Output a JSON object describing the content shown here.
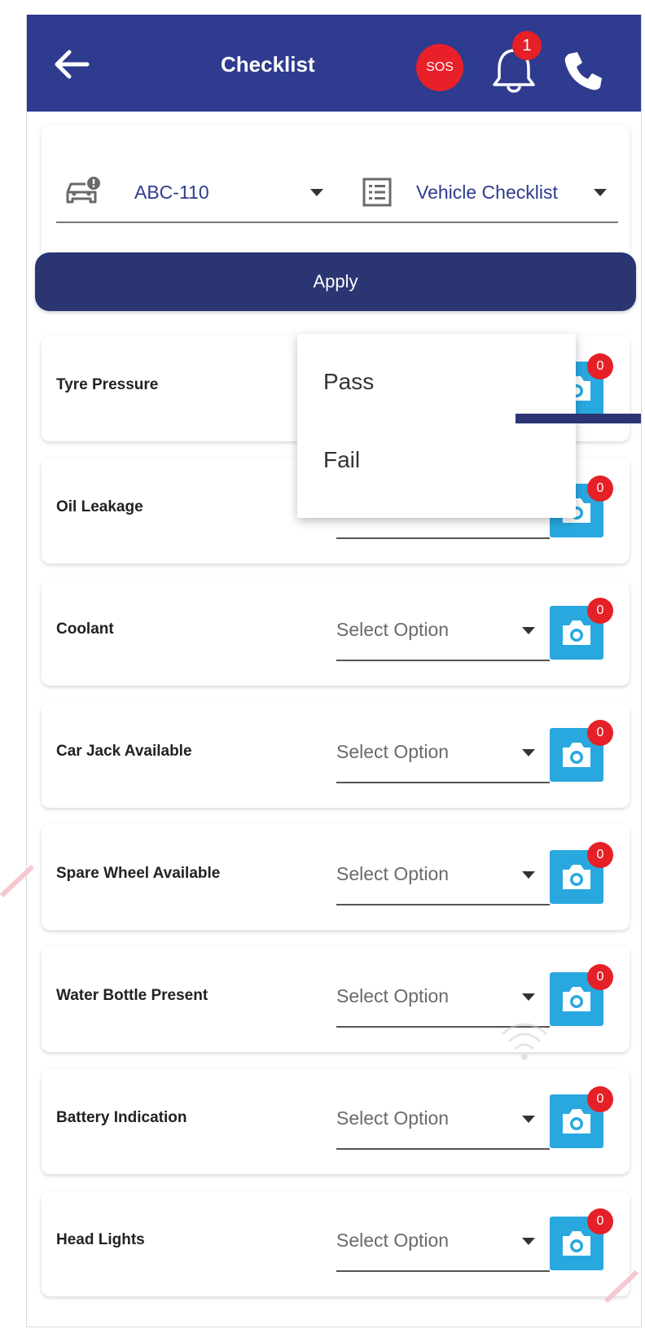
{
  "header": {
    "title": "Checklist",
    "sos_label": "SOS",
    "notification_count": "1"
  },
  "filter": {
    "vehicle": "ABC-110",
    "checklist": "Vehicle Checklist"
  },
  "apply_label": "Apply",
  "dropdown": {
    "options": [
      "Pass",
      "Fail"
    ]
  },
  "items": [
    {
      "label": "Tyre Pressure",
      "value": "",
      "photos": "0"
    },
    {
      "label": "Oil Leakage",
      "value": "",
      "photos": "0"
    },
    {
      "label": "Coolant",
      "value": "Select Option",
      "photos": "0"
    },
    {
      "label": "Car Jack Available",
      "value": "Select Option",
      "photos": "0"
    },
    {
      "label": "Spare Wheel Available",
      "value": "Select Option",
      "photos": "0"
    },
    {
      "label": "Water Bottle Present",
      "value": "Select Option",
      "photos": "0"
    },
    {
      "label": "Battery Indication",
      "value": "Select Option",
      "photos": "0"
    },
    {
      "label": "Head Lights",
      "value": "Select Option",
      "photos": "0"
    }
  ],
  "colors": {
    "header": "#2e3b8f",
    "apply": "#2b3572",
    "camera": "#29a8e0",
    "badge": "#e52027"
  }
}
